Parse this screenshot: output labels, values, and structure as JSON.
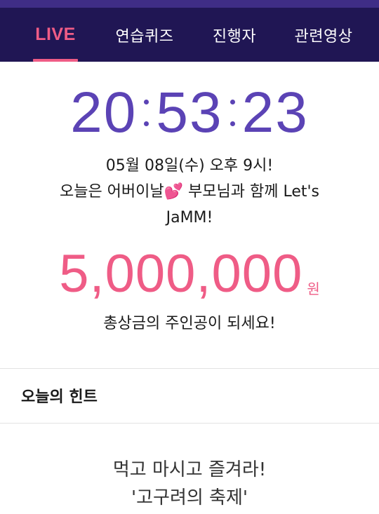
{
  "tabs": [
    {
      "label": "LIVE",
      "active": true
    },
    {
      "label": "연습퀴즈",
      "active": false
    },
    {
      "label": "진행자",
      "active": false
    },
    {
      "label": "관련영상",
      "active": false
    }
  ],
  "timer": {
    "hours": "20",
    "minutes": "53",
    "seconds": "23"
  },
  "event": {
    "date_line": "05월 08일(수) 오후 9시!",
    "line2_before": "오늘은 어버이날",
    "emoji": "💕",
    "line2_after": " 부모님과 함께 Let's",
    "line3": "JaMM!"
  },
  "prize": {
    "amount": "5,000,000",
    "unit": "원"
  },
  "subtitle": "총상금의 주인공이 되세요!",
  "hint": {
    "header": "오늘의 힌트",
    "line1": "먹고 마시고 즐겨라!",
    "line2": "'고구려의 축제'"
  },
  "colors": {
    "nav_bg": "#201654",
    "accent_pink": "#ef5c86",
    "timer_purple": "#5b43b5"
  },
  "icons": {
    "emoji_icon": "two-hearts-icon"
  }
}
